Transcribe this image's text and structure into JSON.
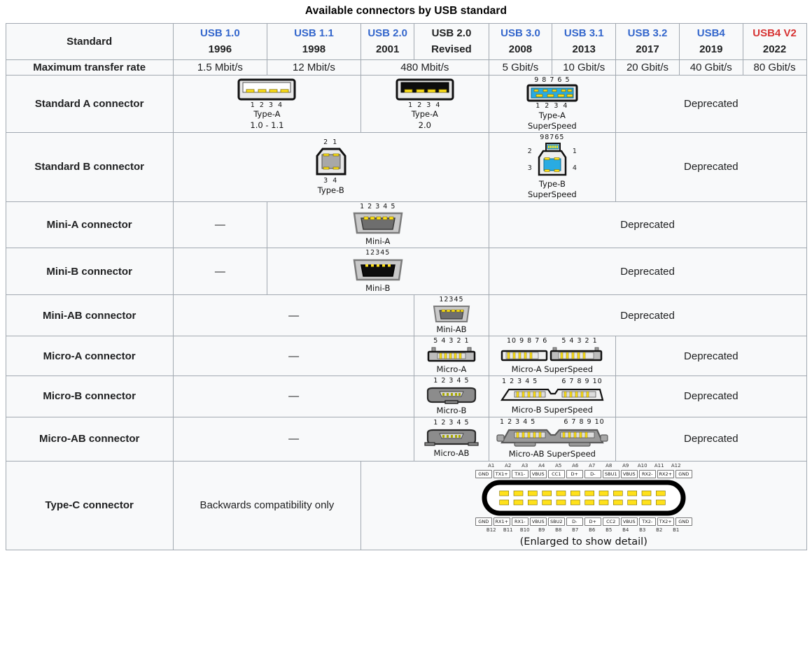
{
  "caption": "Available connectors by USB standard",
  "columns": [
    {
      "key": "standard",
      "label": "Standard"
    },
    {
      "version": "USB 1.0",
      "year": "1996",
      "color": "blue"
    },
    {
      "version": "USB 1.1",
      "year": "1998",
      "color": "blue"
    },
    {
      "version": "USB 2.0",
      "year": "2001",
      "color": "blue"
    },
    {
      "version": "USB 2.0",
      "year": "Revised",
      "color": "black"
    },
    {
      "version": "USB 3.0",
      "year": "2008",
      "color": "blue"
    },
    {
      "version": "USB 3.1",
      "year": "2013",
      "color": "blue"
    },
    {
      "version": "USB 3.2",
      "year": "2017",
      "color": "blue"
    },
    {
      "version": "USB4",
      "year": "2019",
      "color": "blue"
    },
    {
      "version": "USB4 V2",
      "year": "2022",
      "color": "red"
    }
  ],
  "colors": {
    "link_blue": "#3366cc",
    "link_red": "#d73333",
    "header_bg": "#eaecf0",
    "cell_bg": "#f8f9fa",
    "border": "#a2a9b1",
    "pin_yellow": "#ffe11a",
    "superspeed_blue": "#29abe2",
    "body_gray": "#808080",
    "dark_gray": "#6e6e6e"
  },
  "rows": {
    "transfer_rate": {
      "label": "Maximum transfer rate",
      "values": [
        "1.5 Mbit/s",
        "12 Mbit/s",
        "480 Mbit/s",
        "5 Gbit/s",
        "10 Gbit/s",
        "20 Gbit/s",
        "40 Gbit/s",
        "80 Gbit/s"
      ]
    },
    "standard_a": {
      "label": "Standard A connector",
      "fig1": {
        "pins_bottom": "1  2  3  4",
        "cap1": "Type-A",
        "cap2": "1.0 - 1.1"
      },
      "fig2": {
        "pins_bottom": "1  2  3  4",
        "cap1": "Type-A",
        "cap2": "2.0"
      },
      "fig3": {
        "pins_top": "9  8  7  6  5",
        "pins_bottom": "1   2   3   4",
        "cap1": "Type-A",
        "cap2": "SuperSpeed"
      },
      "deprecated": "Deprecated"
    },
    "standard_b": {
      "label": "Standard B connector",
      "fig1": {
        "pins_top": "2  1",
        "pins_bottom": "3  4",
        "cap1": "Type-B"
      },
      "fig2": {
        "pins_top": "98765",
        "left_top": "2",
        "left_bottom": "3",
        "right_top": "1",
        "right_bottom": "4",
        "cap1": "Type-B",
        "cap2": "SuperSpeed"
      },
      "deprecated": "Deprecated"
    },
    "mini_a": {
      "label": "Mini-A connector",
      "dash": "—",
      "fig": {
        "pins_top": "1 2 3 4 5",
        "cap1": "Mini-A"
      },
      "deprecated": "Deprecated"
    },
    "mini_b": {
      "label": "Mini-B connector",
      "dash": "—",
      "fig": {
        "pins_top": "12345",
        "cap1": "Mini-B"
      },
      "deprecated": "Deprecated"
    },
    "mini_ab": {
      "label": "Mini-AB connector",
      "dash": "—",
      "fig": {
        "pins_top": "12345",
        "cap1": "Mini-AB"
      },
      "deprecated": "Deprecated"
    },
    "micro_a": {
      "label": "Micro-A connector",
      "dash": "—",
      "fig": {
        "pins_top": "5 4 3 2 1",
        "cap1": "Micro-A"
      },
      "fig_ss": {
        "pins_left": "10 9 8 7 6",
        "pins_right": "5 4 3 2 1",
        "cap1": "Micro-A SuperSpeed"
      },
      "deprecated": "Deprecated"
    },
    "micro_b": {
      "label": "Micro-B connector",
      "dash": "—",
      "fig": {
        "pins_top": "1 2 3 4 5",
        "cap1": "Micro-B"
      },
      "fig_ss": {
        "pins_left": "1 2 3 4 5",
        "pins_right": "6 7 8 9 10",
        "cap1": "Micro-B SuperSpeed"
      },
      "deprecated": "Deprecated"
    },
    "micro_ab": {
      "label": "Micro-AB connector",
      "dash": "—",
      "fig": {
        "pins_top": "1 2 3 4 5",
        "cap1": "Micro-AB"
      },
      "fig_ss": {
        "pins_left": "1 2 3 4 5",
        "pins_right": "6 7 8 9 10",
        "cap1": "Micro-AB SuperSpeed"
      },
      "deprecated": "Deprecated"
    },
    "type_c": {
      "label": "Type-C connector",
      "backwards": "Backwards compatibility only",
      "note": "(Enlarged to show detail)",
      "top_pin_ids": [
        "A1",
        "A2",
        "A3",
        "A4",
        "A5",
        "A6",
        "A7",
        "A8",
        "A9",
        "A10",
        "A11",
        "A12"
      ],
      "top_pin_names": [
        "GND",
        "TX1+",
        "TX1-",
        "VBUS",
        "CC1",
        "D+",
        "D-",
        "SBU1",
        "VBUS",
        "RX2-",
        "RX2+",
        "GND"
      ],
      "bottom_pin_names": [
        "GND",
        "RX1+",
        "RX1-",
        "VBUS",
        "SBU2",
        "D-",
        "D+",
        "CC2",
        "VBUS",
        "TX2-",
        "TX2+",
        "GND"
      ],
      "bottom_pin_ids": [
        "B12",
        "B11",
        "B10",
        "B9",
        "B8",
        "B7",
        "B6",
        "B5",
        "B4",
        "B3",
        "B2",
        "B1"
      ]
    }
  }
}
